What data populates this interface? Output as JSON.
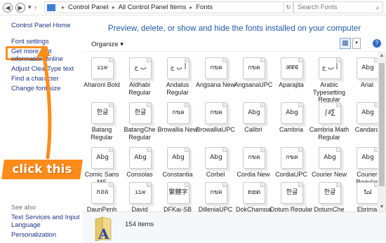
{
  "address": {
    "path": [
      "Control Panel",
      "All Control Panel Items",
      "Fonts"
    ],
    "search_placeholder": "Search Fonts"
  },
  "sidebar": {
    "links": [
      {
        "label": "Control Panel Home"
      },
      {
        "label": "Font settings"
      },
      {
        "label": "Get more font information online"
      },
      {
        "label": "Adjust ClearType text"
      },
      {
        "label": "Find a character"
      },
      {
        "label": "Change font size"
      }
    ],
    "see_also": "See also",
    "see_also_links": [
      {
        "label": "Text Services and Input Language"
      },
      {
        "label": "Personalization"
      }
    ]
  },
  "header": {
    "text": "Preview, delete, or show and hide the fonts installed on your computer"
  },
  "toolbar": {
    "organize": "Organize",
    "organize_arrow": "▾",
    "view_glyph": "▦",
    "dropdown_glyph": "▾",
    "help_glyph": "?"
  },
  "fonts": [
    {
      "name": "Aharoni Bold",
      "sample": "אבג"
    },
    {
      "name": "Aldhabi Regular",
      "sample": "ب ج"
    },
    {
      "name": "Andalus Regular",
      "sample": "أ ب ج"
    },
    {
      "name": "Angsana New",
      "sample": "กขค"
    },
    {
      "name": "AngsanaUPC",
      "sample": "กขค"
    },
    {
      "name": "Aparajita",
      "sample": "अबच"
    },
    {
      "name": "Arabic Typesetting Regular",
      "sample": "أ ب ج"
    },
    {
      "name": "Arial",
      "sample": "Abg"
    },
    {
      "name": "Batang Regular",
      "sample": "한글"
    },
    {
      "name": "BatangChe Regular",
      "sample": "한글"
    },
    {
      "name": "Browallia New",
      "sample": "กขค"
    },
    {
      "name": "BrowalliaUPC",
      "sample": "กขค"
    },
    {
      "name": "Calibri",
      "sample": "Abg"
    },
    {
      "name": "Cambria",
      "sample": "Abg"
    },
    {
      "name": "Cambria Math Regular",
      "sample": "∫∂∑"
    },
    {
      "name": "Candara",
      "sample": "Abg"
    },
    {
      "name": "Comic Sans MS",
      "sample": "Abg"
    },
    {
      "name": "Consolas",
      "sample": "Abg"
    },
    {
      "name": "Constantia",
      "sample": "Abg"
    },
    {
      "name": "Corbel",
      "sample": "Abg"
    },
    {
      "name": "Cordia New",
      "sample": "กขค"
    },
    {
      "name": "CordiaUPC",
      "sample": "กขค"
    },
    {
      "name": "Courier New",
      "sample": "Abg"
    },
    {
      "name": "Courier Regular",
      "sample": "Abg"
    },
    {
      "name": "DaunPenh Regular",
      "sample": "កខគ"
    },
    {
      "name": "David",
      "sample": "אבג"
    },
    {
      "name": "DFKai-SB Regular",
      "sample": "繁體字"
    },
    {
      "name": "DilleniaUPC",
      "sample": "กขค"
    },
    {
      "name": "DokChampa Regular",
      "sample": "ກຂຄ"
    },
    {
      "name": "Dotum Regular",
      "sample": "한글"
    },
    {
      "name": "DotumChe Regular",
      "sample": "한글"
    },
    {
      "name": "Ebrima",
      "sample": "ߊߋߌ"
    }
  ],
  "status": {
    "count": "154 items"
  },
  "annotation": {
    "text": "click this",
    "color": "#ff8c1a"
  }
}
